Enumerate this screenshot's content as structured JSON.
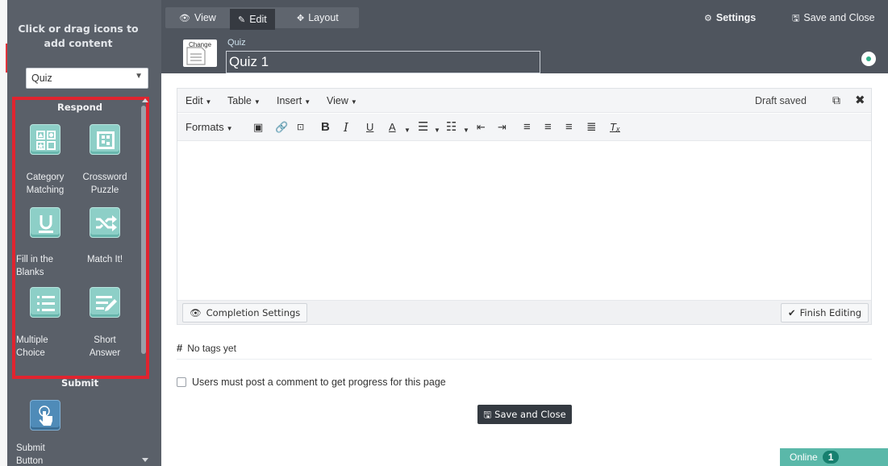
{
  "sidebar": {
    "heading": "Click or drag icons to add content",
    "select_value": "Quiz",
    "groups": [
      {
        "title": "Respond",
        "items": [
          {
            "label": "Category Matching",
            "icon": "category-matching-icon"
          },
          {
            "label": "Crossword Puzzle",
            "icon": "crossword-icon"
          },
          {
            "label": "Fill in the Blanks",
            "icon": "underline-icon"
          },
          {
            "label": "Match It!",
            "icon": "shuffle-icon"
          },
          {
            "label": "Multiple Choice",
            "icon": "list-icon"
          },
          {
            "label": "Short Answer",
            "icon": "pencil-lines-icon"
          }
        ]
      },
      {
        "title": "Submit",
        "items": [
          {
            "label": "Submit Button",
            "icon": "hand-pointer-icon"
          }
        ]
      }
    ]
  },
  "topbar": {
    "view": "View",
    "edit": "Edit",
    "layout": "Layout",
    "settings": "Settings",
    "save_close": "Save and Close",
    "change": "Change",
    "page_type": "Quiz",
    "title": "Quiz 1"
  },
  "editor": {
    "menus": [
      "Edit",
      "Table",
      "Insert",
      "View"
    ],
    "formats": "Formats",
    "draft_status": "Draft saved",
    "completion_settings": "Completion Settings",
    "finish_editing": "Finish Editing"
  },
  "tags_text": "No tags yet",
  "comment_requirement": "Users must post a comment to get progress for this page",
  "save_close_bottom": "Save and Close",
  "online": {
    "label": "Online",
    "count": "1"
  },
  "colors": {
    "accent": "#8dcfc7",
    "highlight": "#e0242f",
    "online": "#5ab8a9"
  }
}
